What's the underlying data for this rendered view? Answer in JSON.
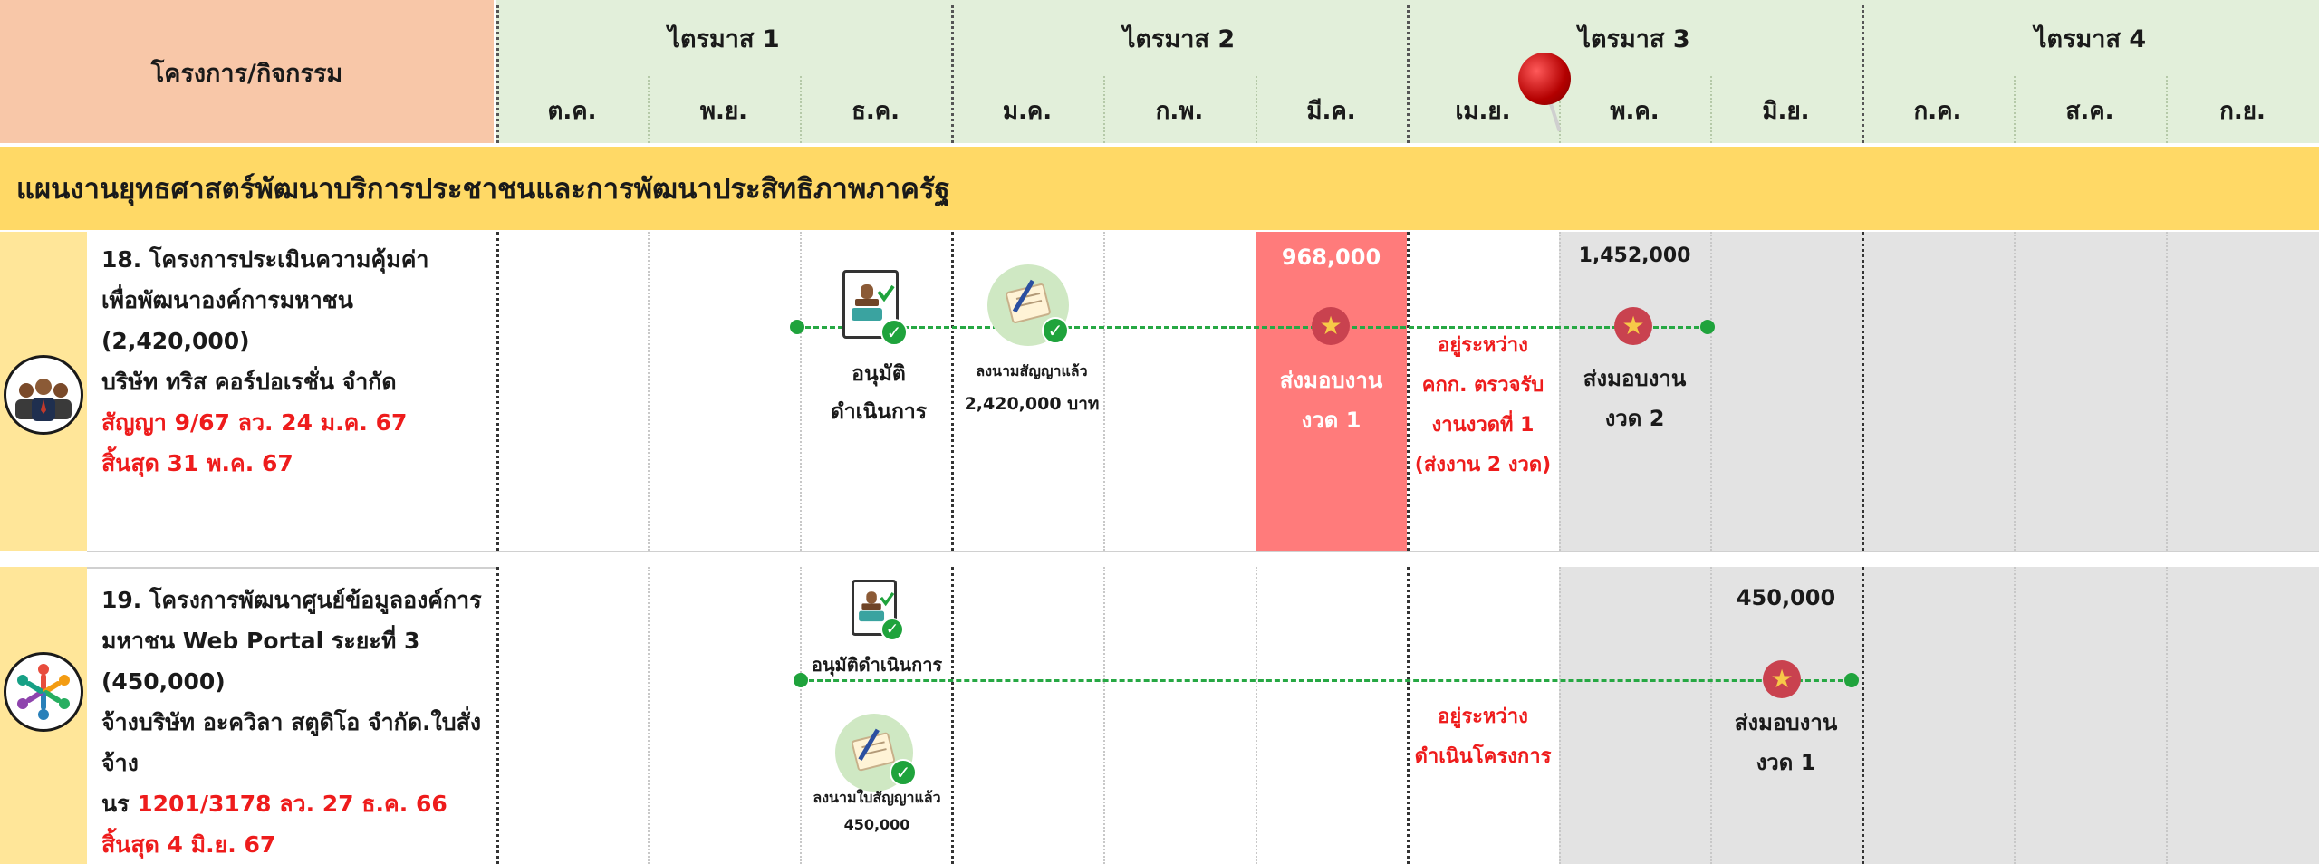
{
  "header": {
    "project_col": "โครงการ/กิจกรรม",
    "quarters": [
      "ไตรมาส 1",
      "ไตรมาส 2",
      "ไตรมาส 3",
      "ไตรมาส 4"
    ],
    "months": [
      "ต.ค.",
      "พ.ย.",
      "ธ.ค.",
      "ม.ค.",
      "ก.พ.",
      "มี.ค.",
      "เม.ย.",
      "พ.ค.",
      "มิ.ย.",
      "ก.ค.",
      "ส.ค.",
      "ก.ย."
    ]
  },
  "plan_title": "แผนงานยุทธศาสตร์พัฒนาบริการประชาชนและการพัฒนาประสิทธิภาพภาครัฐ",
  "project18": {
    "line1": "18. โครงการประเมินความคุ้มค่า",
    "line2": "เพื่อพัฒนาองค์การมหาชน (2,420,000)",
    "line3": "บริษัท ทริส คอร์ปอเรชั่น จำกัด",
    "line4": "สัญญา 9/67 ลว. 24 ม.ค. 67",
    "line5": "สิ้นสุด 31 พ.ค. 67",
    "approve_1": "อนุมัติ",
    "approve_2": "ดำเนินการ",
    "signed": "ลงนามสัญญาแล้ว",
    "signed_amount": "2,420,000 บาท",
    "amount_mar": "968,000",
    "deliver1_a": "ส่งมอบงาน",
    "deliver1_b": "งวด 1",
    "status_1": "อยู่ระหว่าง",
    "status_2": "คกก. ตรวจรับ",
    "status_3": "งานงวดที่ 1",
    "status_4": "(ส่งงาน 2 งวด)",
    "amount_may": "1,452,000",
    "deliver2_a": "ส่งมอบงาน",
    "deliver2_b": "งวด 2"
  },
  "project19": {
    "line1": "19. โครงการพัฒนาศูนย์ข้อมูลองค์การ",
    "line2": "มหาชน Web Portal ระยะที่ 3",
    "line3": "(450,000)",
    "line4": "จ้างบริษัท อะควิลา สตูดิโอ จำกัด.ใบสั่งจ้าง",
    "line5a": "นร ",
    "line5b": "1201/3178 ลว. 27 ธ.ค. 66",
    "line6": "สิ้นสุด 4 มิ.ย. 67",
    "approve": "อนุมัติดำเนินการ",
    "signed": "ลงนามใบสัญญาแล้ว",
    "signed_amount": "450,000",
    "status_1": "อยู่ระหว่าง",
    "status_2": "ดำเนินโครงการ",
    "amount_jun": "450,000",
    "deliver_a": "ส่งมอบงาน",
    "deliver_b": "งวด 1"
  },
  "icons": {
    "avatar18": "business-people-icon",
    "avatar19": "team-people-icon",
    "milestone": "star-icon",
    "approve": "approved-document-icon",
    "sign": "signed-contract-icon",
    "pin": "map-pin-icon"
  },
  "colors": {
    "header_project": "#f8c7a8",
    "header_months": "#e2efda",
    "plan_bar": "#ffd966",
    "sidebar": "#ffe699",
    "highlight": "#ff7b7b",
    "future": "#e3e3e3",
    "timeline": "#27a844",
    "red_text": "#ee1c1c"
  }
}
